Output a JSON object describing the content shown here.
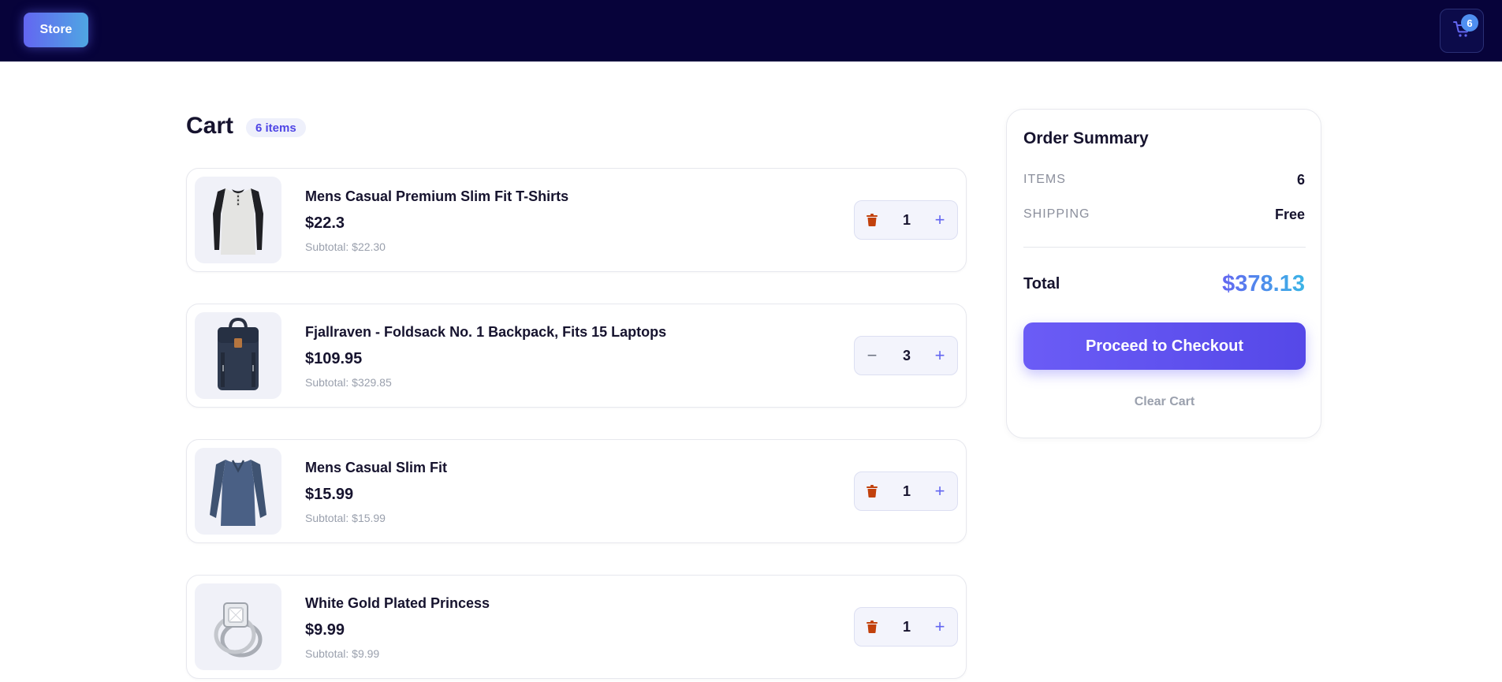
{
  "navbar": {
    "store_label": "Store",
    "cart_count": "6"
  },
  "cart": {
    "title": "Cart",
    "items_pill": "6 items",
    "items": [
      {
        "name": "Mens Casual Premium Slim Fit T-Shirts",
        "price": "$22.3",
        "subtotal": "Subtotal: $22.30",
        "quantity": "1",
        "decrement": "trash-icon",
        "thumb": "henley-shirt-image"
      },
      {
        "name": "Fjallraven - Foldsack No. 1 Backpack, Fits 15 Laptops",
        "price": "$109.95",
        "subtotal": "Subtotal: $329.85",
        "quantity": "3",
        "decrement": "minus-icon",
        "thumb": "backpack-image"
      },
      {
        "name": "Mens Casual Slim Fit",
        "price": "$15.99",
        "subtotal": "Subtotal: $15.99",
        "quantity": "1",
        "decrement": "trash-icon",
        "thumb": "long-sleeve-shirt-image"
      },
      {
        "name": "White Gold Plated Princess",
        "price": "$9.99",
        "subtotal": "Subtotal: $9.99",
        "quantity": "1",
        "decrement": "trash-icon",
        "thumb": "ring-image"
      }
    ]
  },
  "summary": {
    "title": "Order Summary",
    "items_label": "ITEMS",
    "items_value": "6",
    "shipping_label": "SHIPPING",
    "shipping_value": "Free",
    "total_label": "Total",
    "total_value": "$378.13",
    "checkout_label": "Proceed to Checkout",
    "clear_label": "Clear Cart"
  },
  "colors": {
    "navbar_bg": "#07033a",
    "accent": "#6366f1",
    "accent_light": "#3ab5e6",
    "trash": "#c2410c"
  }
}
